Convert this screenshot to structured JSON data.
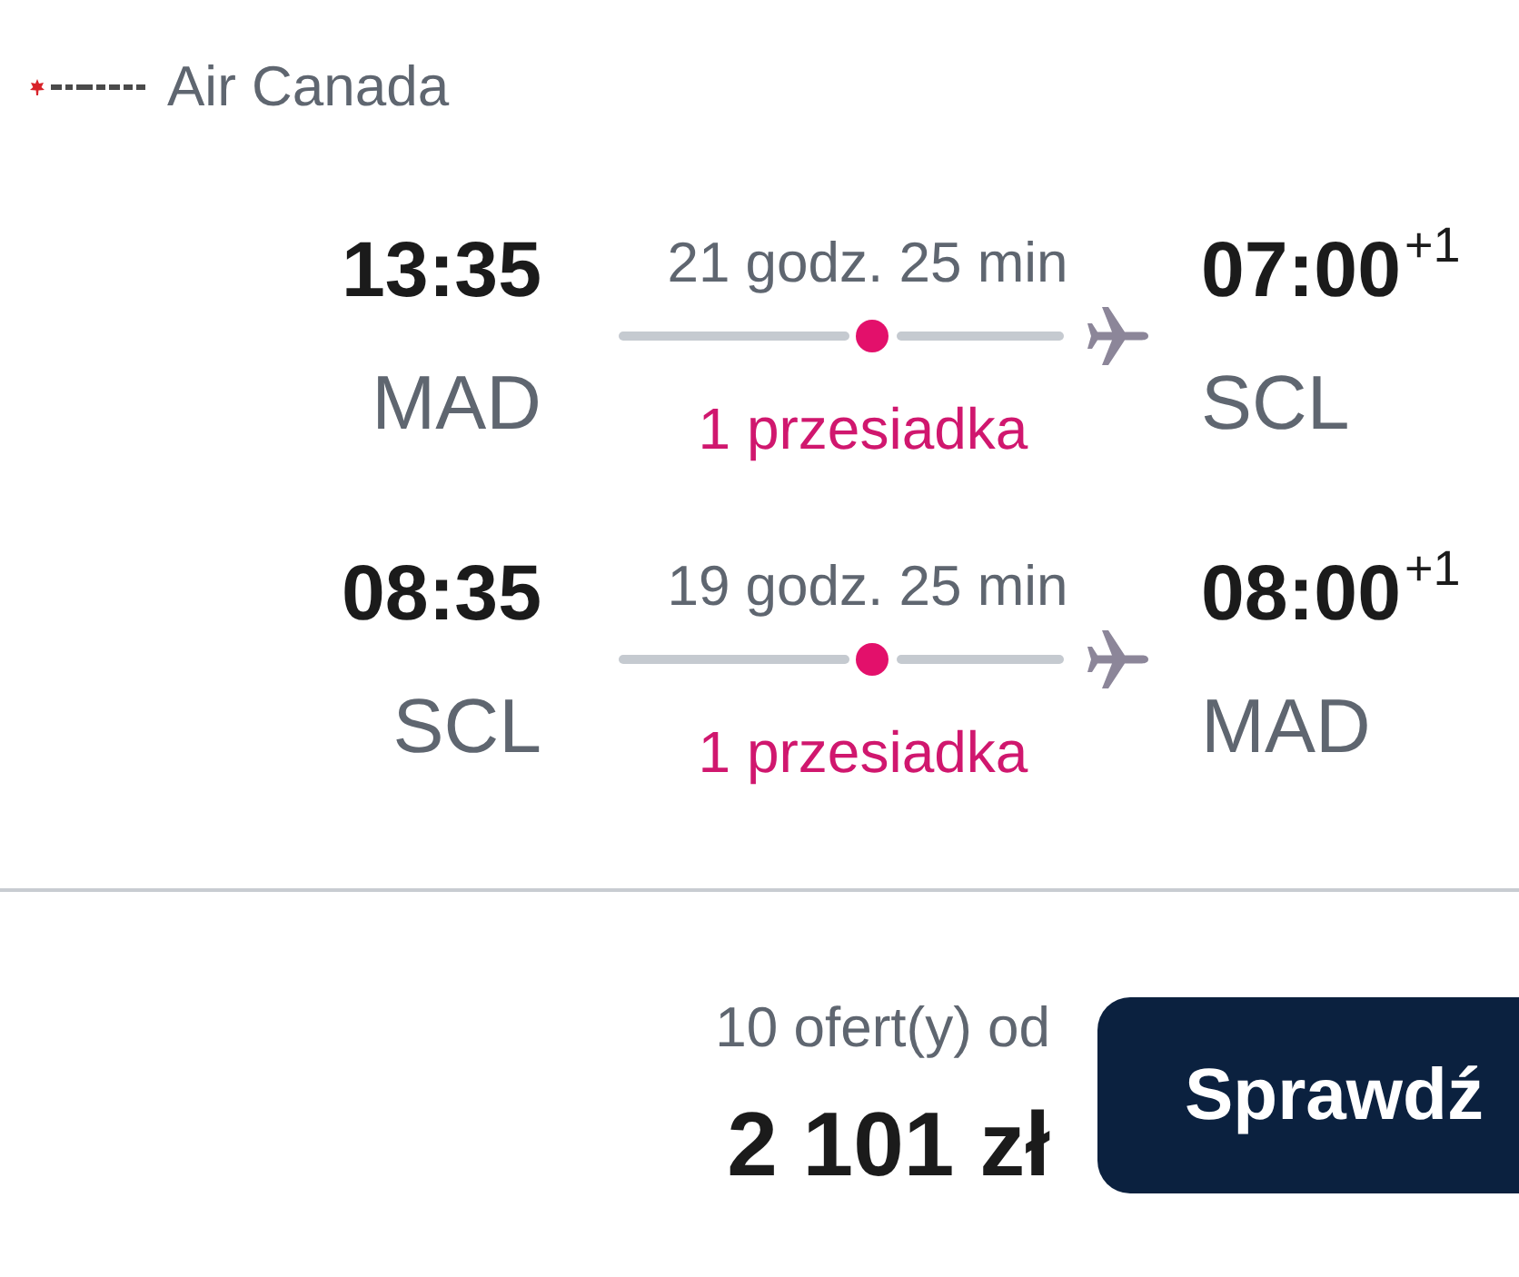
{
  "airline": {
    "name": "Air Canada"
  },
  "legs": [
    {
      "departure": {
        "time": "13:35",
        "airport": "MAD"
      },
      "duration": "21 godz. 25 min",
      "stops": "1 przesiadka",
      "arrival": {
        "time": "07:00",
        "day_offset": "+1",
        "airport": "SCL"
      }
    },
    {
      "departure": {
        "time": "08:35",
        "airport": "SCL"
      },
      "duration": "19 godz. 25 min",
      "stops": "1 przesiadka",
      "arrival": {
        "time": "08:00",
        "day_offset": "+1",
        "airport": "MAD"
      }
    }
  ],
  "offer": {
    "count_text": "10 ofert(y) od",
    "price": "2 101 zł",
    "button": "Sprawdź"
  }
}
